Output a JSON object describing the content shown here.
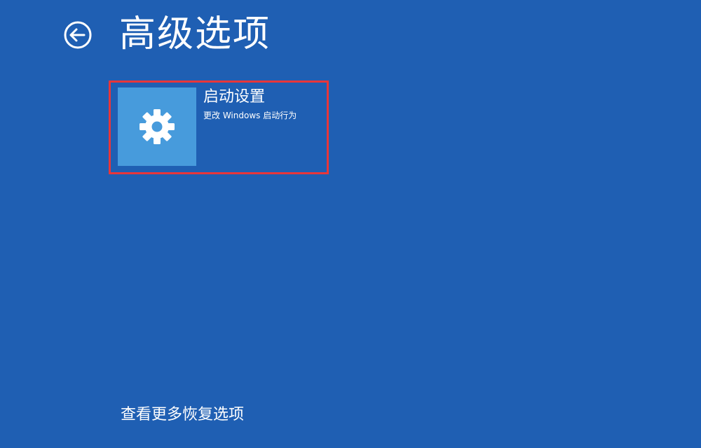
{
  "header": {
    "back_icon": "back-arrow-circle-icon",
    "title": "高级选项"
  },
  "options": [
    {
      "icon": "gear-icon",
      "title": "启动设置",
      "description": "更改 Windows 启动行为",
      "highlight_color": "#e8363a"
    }
  ],
  "footer": {
    "more_options_link": "查看更多恢复选项"
  },
  "colors": {
    "background": "#1f5fb3",
    "tile_icon_bg": "#479bdc",
    "text": "#ffffff"
  }
}
